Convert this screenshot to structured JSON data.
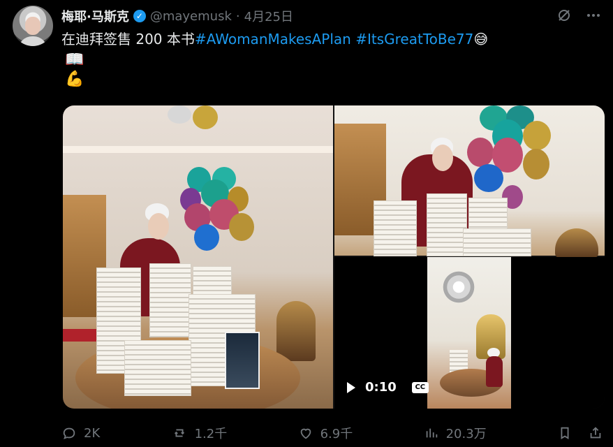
{
  "author": {
    "name": "梅耶·马斯克",
    "handle": "@mayemusk",
    "date": "4月25日",
    "separator": "·"
  },
  "tweet": {
    "text_prefix": "在迪拜签售 200 本书",
    "hashtag_1": "#AWomanMakesAPlan",
    "hashtag_2": "#ItsGreatToBe77",
    "emoji_1": "😅",
    "emoji_2": "📖",
    "emoji_3": "💪"
  },
  "video": {
    "duration": "0:10",
    "cc_label": "CC"
  },
  "actions": {
    "reply_count": "2K",
    "retweet_count": "1.2千",
    "like_count": "6.9千",
    "view_count": "20.3万"
  },
  "icons": {
    "grok": "grok-icon",
    "more": "more-icon",
    "reply": "reply-icon",
    "retweet": "retweet-icon",
    "like": "like-icon",
    "views": "views-icon",
    "bookmark": "bookmark-icon",
    "share": "share-icon",
    "verified": "verified-icon",
    "play": "play-icon"
  },
  "colors": {
    "background": "#000000",
    "text": "#e7e9ea",
    "muted": "#71767b",
    "accent": "#1d9bf0"
  }
}
